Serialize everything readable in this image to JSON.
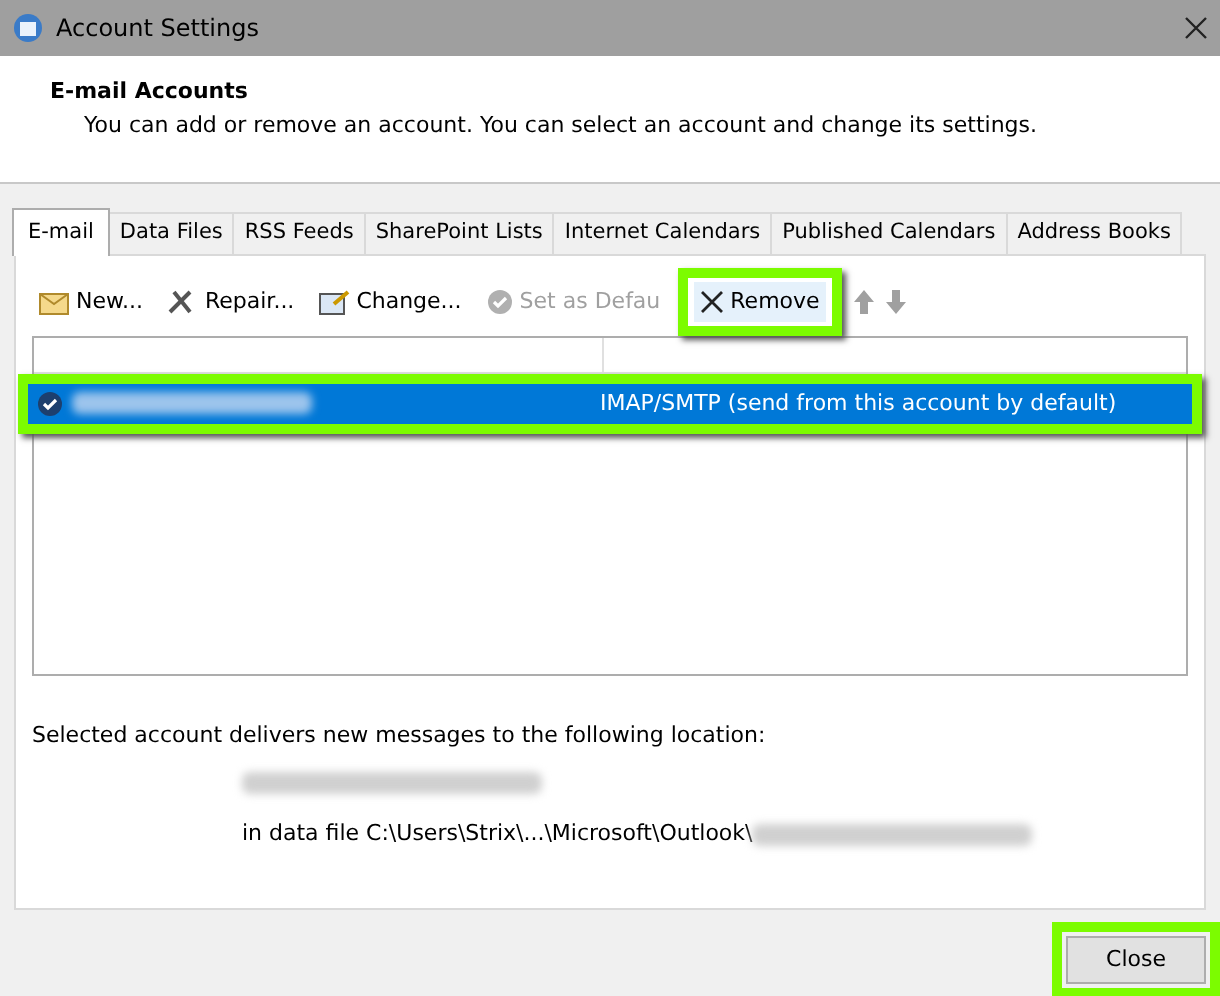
{
  "window": {
    "title": "Account Settings"
  },
  "header": {
    "title": "E-mail Accounts",
    "description": "You can add or remove an account. You can select an account and change its settings."
  },
  "tabs": [
    {
      "label": "E-mail",
      "selected": true
    },
    {
      "label": "Data Files",
      "selected": false
    },
    {
      "label": "RSS Feeds",
      "selected": false
    },
    {
      "label": "SharePoint Lists",
      "selected": false
    },
    {
      "label": "Internet Calendars",
      "selected": false
    },
    {
      "label": "Published Calendars",
      "selected": false
    },
    {
      "label": "Address Books",
      "selected": false
    }
  ],
  "toolbar": [
    {
      "kind": "button",
      "label": "New...",
      "disabled": false,
      "highlighted": false
    },
    {
      "kind": "button",
      "label": "Repair...",
      "disabled": false,
      "highlighted": false
    },
    {
      "kind": "button",
      "label": "Change...",
      "disabled": false,
      "highlighted": false
    },
    {
      "kind": "button",
      "label": "Set as Defau",
      "disabled": true,
      "highlighted": false
    },
    {
      "kind": "button",
      "label": "Remove",
      "disabled": false,
      "highlighted": true
    },
    {
      "kind": "arrow",
      "disabled": true
    },
    {
      "kind": "arrow",
      "disabled": true
    }
  ],
  "accounts": [
    {
      "type": "IMAP/SMTP (send from this account by default)",
      "selected": true,
      "highlighted": true,
      "default": true
    }
  ],
  "location": {
    "label": "Selected account delivers new messages to the following location:",
    "data_file": "in data file C:\\Users\\Strix\\...\\Microsoft\\Outlook\\"
  },
  "buttons": [
    {
      "label": "Close",
      "highlighted": true
    }
  ]
}
